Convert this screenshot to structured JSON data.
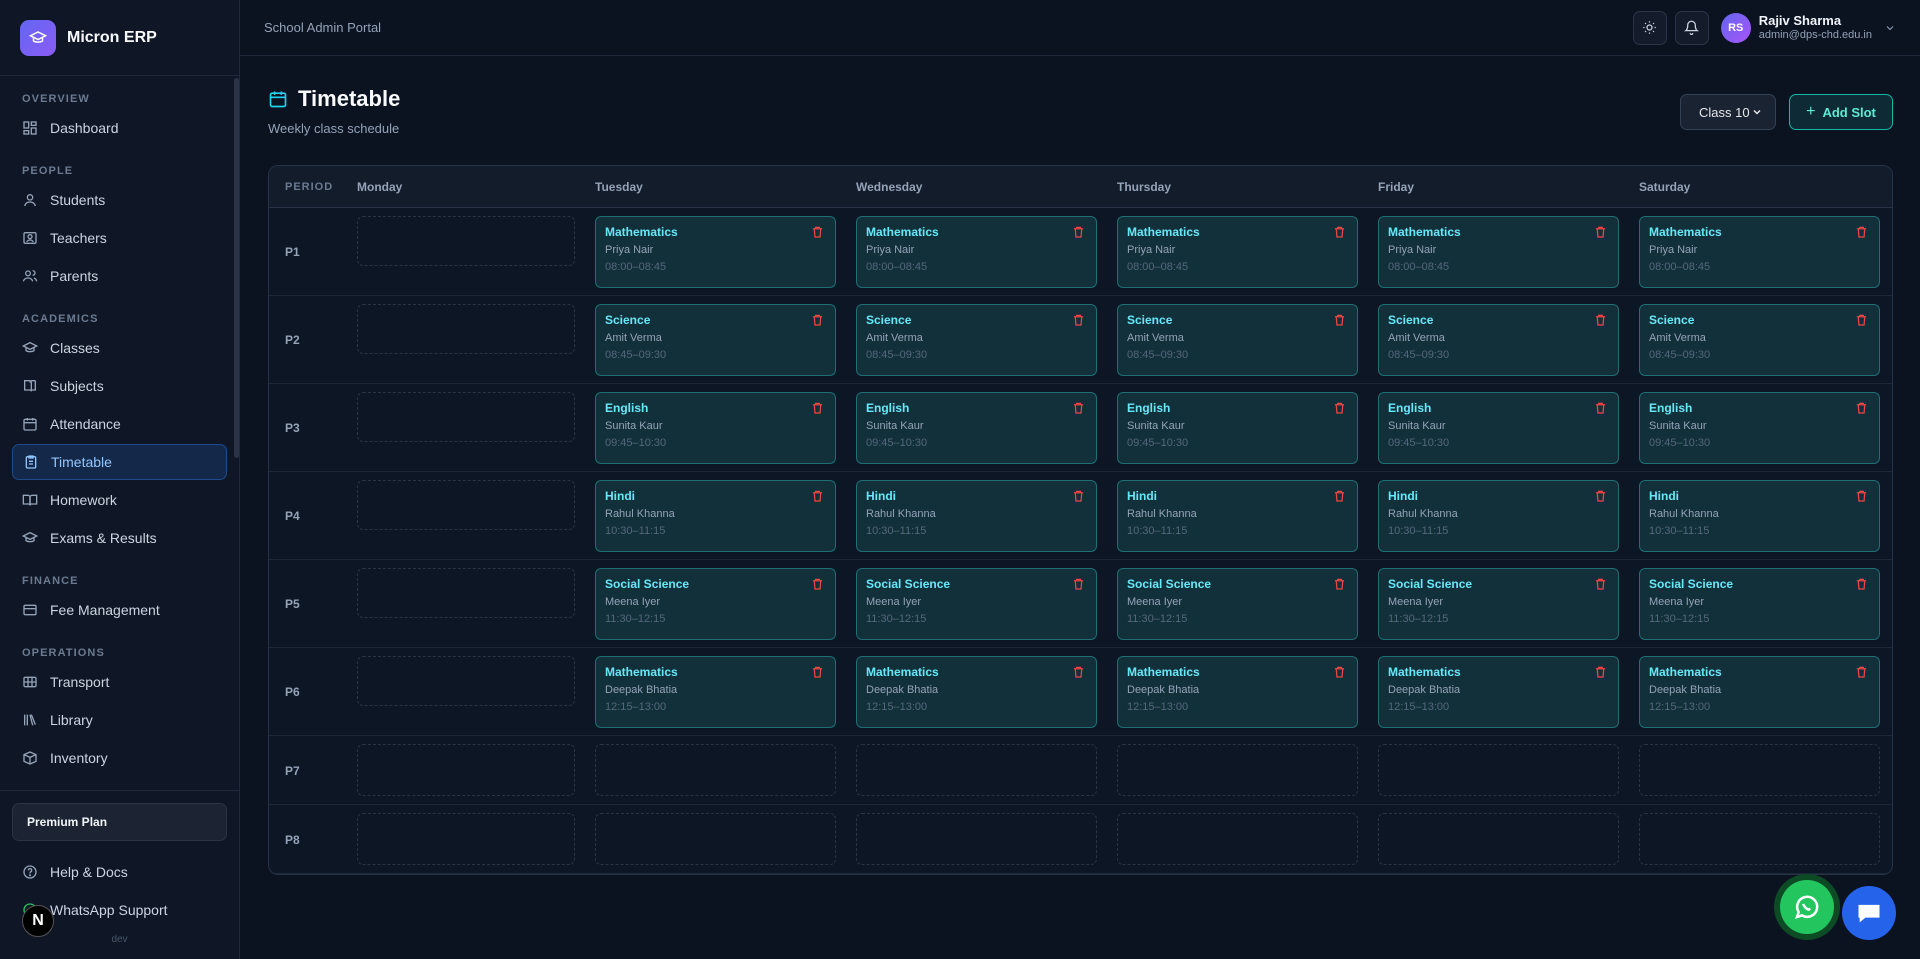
{
  "brand": {
    "name": "Micron ERP"
  },
  "sidebar": {
    "sections": [
      {
        "title": "OVERVIEW",
        "items": [
          {
            "label": "Dashboard",
            "icon": "dashboard-icon"
          }
        ]
      },
      {
        "title": "PEOPLE",
        "items": [
          {
            "label": "Students",
            "icon": "user-icon"
          },
          {
            "label": "Teachers",
            "icon": "id-card-icon"
          },
          {
            "label": "Parents",
            "icon": "users-icon"
          }
        ]
      },
      {
        "title": "ACADEMICS",
        "items": [
          {
            "label": "Classes",
            "icon": "graduation-cap-icon"
          },
          {
            "label": "Subjects",
            "icon": "book-icon"
          },
          {
            "label": "Attendance",
            "icon": "calendar-icon"
          },
          {
            "label": "Timetable",
            "icon": "clipboard-icon",
            "active": true
          },
          {
            "label": "Homework",
            "icon": "book-open-icon"
          },
          {
            "label": "Exams & Results",
            "icon": "graduation-cap-icon"
          }
        ]
      },
      {
        "title": "FINANCE",
        "items": [
          {
            "label": "Fee Management",
            "icon": "wallet-icon"
          }
        ]
      },
      {
        "title": "OPERATIONS",
        "items": [
          {
            "label": "Transport",
            "icon": "bus-icon"
          },
          {
            "label": "Library",
            "icon": "library-icon"
          },
          {
            "label": "Inventory",
            "icon": "box-icon"
          }
        ]
      }
    ],
    "plan_label": "Premium Plan",
    "help_label": "Help & Docs",
    "whatsapp_label": "WhatsApp Support",
    "avatar_letter": "N",
    "env_label": "dev"
  },
  "header": {
    "portal_title": "School Admin Portal",
    "user_initials": "RS",
    "user_name": "Rajiv Sharma",
    "user_email": "admin@dps-chd.edu.in"
  },
  "page": {
    "title": "Timetable",
    "subtitle": "Weekly class schedule",
    "class_selected": "Class 10",
    "add_slot_label": "Add Slot"
  },
  "timetable": {
    "period_header": "PERIOD",
    "days": [
      "Monday",
      "Tuesday",
      "Wednesday",
      "Thursday",
      "Friday",
      "Saturday"
    ],
    "periods": [
      {
        "label": "P1",
        "subject": "Mathematics",
        "teacher": "Priya Nair",
        "time": "08:00–08:45"
      },
      {
        "label": "P2",
        "subject": "Science",
        "teacher": "Amit Verma",
        "time": "08:45–09:30"
      },
      {
        "label": "P3",
        "subject": "English",
        "teacher": "Sunita Kaur",
        "time": "09:45–10:30"
      },
      {
        "label": "P4",
        "subject": "Hindi",
        "teacher": "Rahul Khanna",
        "time": "10:30–11:15"
      },
      {
        "label": "P5",
        "subject": "Social Science",
        "teacher": "Meena Iyer",
        "time": "11:30–12:15"
      },
      {
        "label": "P6",
        "subject": "Mathematics",
        "teacher": "Deepak Bhatia",
        "time": "12:15–13:00"
      },
      {
        "label": "P7"
      },
      {
        "label": "P8"
      }
    ],
    "filled_days": [
      "Tuesday",
      "Wednesday",
      "Thursday",
      "Friday",
      "Saturday"
    ]
  },
  "colors": {
    "accent": "#14b8a6",
    "active_nav": "#93c5fd",
    "brand": "#6366f1",
    "whatsapp": "#22c55e",
    "chat": "#2563eb"
  }
}
